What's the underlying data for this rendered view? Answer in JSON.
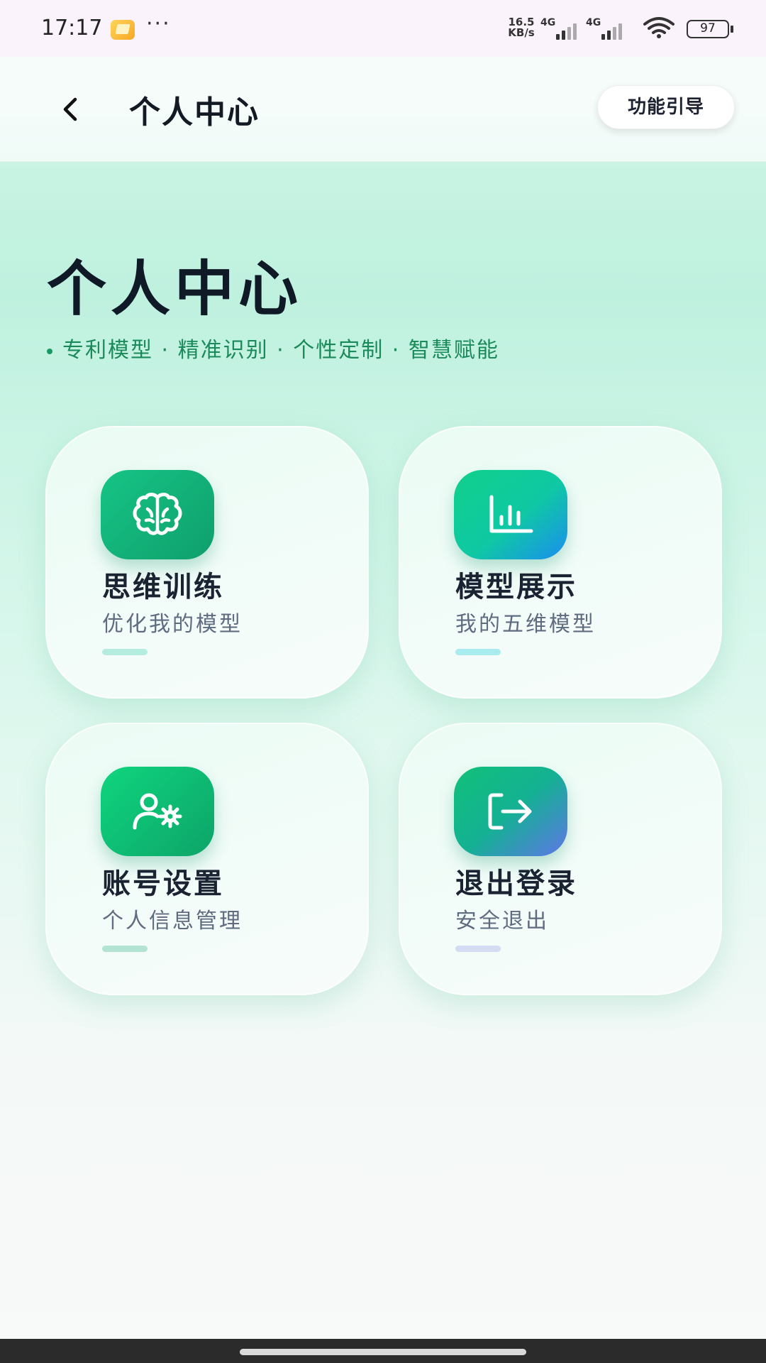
{
  "status_bar": {
    "time": "17:17",
    "dots": "···",
    "net_speed_value": "16.5",
    "net_speed_unit": "KB/s",
    "network_1": "4G",
    "network_2": "4G",
    "battery": "97"
  },
  "header": {
    "title": "个人中心",
    "guide_button": "功能引导"
  },
  "hero": {
    "title": "个人中心",
    "tagline": "专利模型 · 精准识别 · 个性定制 · 智慧赋能"
  },
  "cards": [
    {
      "title": "思维训练",
      "subtitle": "优化我的模型",
      "icon": "brain-icon",
      "accent": "#b5ece0"
    },
    {
      "title": "模型展示",
      "subtitle": "我的五维模型",
      "icon": "bar-chart-icon",
      "accent": "#a9ecef"
    },
    {
      "title": "账号设置",
      "subtitle": "个人信息管理",
      "icon": "user-settings-icon",
      "accent": "#b3e3d3"
    },
    {
      "title": "退出登录",
      "subtitle": "安全退出",
      "icon": "logout-icon",
      "accent": "#d3dcf2"
    }
  ],
  "colors": {
    "primary_green": "#12b07a",
    "tagline": "#1a8a5a",
    "title": "#0f1a26"
  }
}
